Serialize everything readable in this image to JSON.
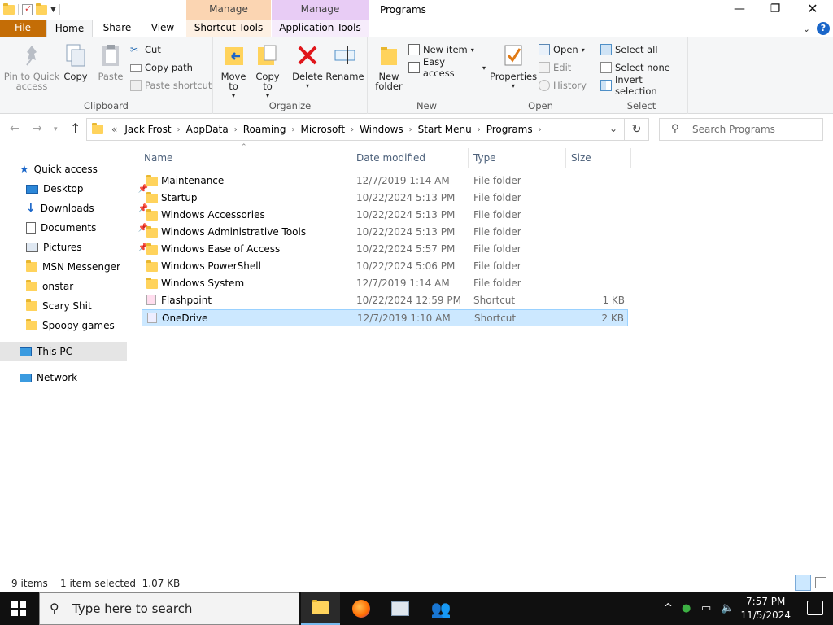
{
  "window": {
    "title": "Programs",
    "context_tabs": {
      "manage_shortcut": "Manage",
      "manage_application": "Manage"
    },
    "tabs": [
      "File",
      "Home",
      "Share",
      "View",
      "Shortcut Tools",
      "Application Tools"
    ],
    "help": "?"
  },
  "ribbon": {
    "clipboard": {
      "label": "Clipboard",
      "pin": "Pin to Quick access",
      "copy": "Copy",
      "paste": "Paste",
      "cut": "Cut",
      "copy_path": "Copy path",
      "paste_shortcut": "Paste shortcut"
    },
    "organize": {
      "label": "Organize",
      "move_to": "Move to",
      "copy_to": "Copy to",
      "delete": "Delete",
      "rename": "Rename"
    },
    "new": {
      "label": "New",
      "new_folder": "New folder",
      "new_item": "New item",
      "easy_access": "Easy access"
    },
    "open": {
      "label": "Open",
      "properties": "Properties",
      "open": "Open",
      "edit": "Edit",
      "history": "History"
    },
    "select": {
      "label": "Select",
      "select_all": "Select all",
      "select_none": "Select none",
      "invert": "Invert selection"
    }
  },
  "address": {
    "prefix": "«",
    "crumbs": [
      "Jack Frost",
      "AppData",
      "Roaming",
      "Microsoft",
      "Windows",
      "Start Menu",
      "Programs"
    ],
    "search_placeholder": "Search Programs"
  },
  "nav": {
    "quick_access": "Quick access",
    "items": [
      "Desktop",
      "Downloads",
      "Documents",
      "Pictures",
      "MSN Messenger",
      "onstar",
      "Scary Shit",
      "Spoopy games"
    ],
    "this_pc": "This PC",
    "network": "Network"
  },
  "columns": [
    "Name",
    "Date modified",
    "Type",
    "Size"
  ],
  "files": [
    {
      "name": "Maintenance",
      "date": "12/7/2019 1:14 AM",
      "type": "File folder",
      "size": ""
    },
    {
      "name": "Startup",
      "date": "10/22/2024 5:13 PM",
      "type": "File folder",
      "size": ""
    },
    {
      "name": "Windows Accessories",
      "date": "10/22/2024 5:13 PM",
      "type": "File folder",
      "size": ""
    },
    {
      "name": "Windows Administrative Tools",
      "date": "10/22/2024 5:13 PM",
      "type": "File folder",
      "size": ""
    },
    {
      "name": "Windows Ease of Access",
      "date": "10/22/2024 5:57 PM",
      "type": "File folder",
      "size": ""
    },
    {
      "name": "Windows PowerShell",
      "date": "10/22/2024 5:06 PM",
      "type": "File folder",
      "size": ""
    },
    {
      "name": "Windows System",
      "date": "12/7/2019 1:14 AM",
      "type": "File folder",
      "size": ""
    },
    {
      "name": "Flashpoint",
      "date": "10/22/2024 12:59 PM",
      "type": "Shortcut",
      "size": "1 KB"
    },
    {
      "name": "OneDrive",
      "date": "12/7/2019 1:10 AM",
      "type": "Shortcut",
      "size": "2 KB"
    }
  ],
  "status": {
    "items": "9 items",
    "selected": "1 item selected  1.07 KB"
  },
  "taskbar": {
    "search_placeholder": "Type here to search",
    "time": "7:57 PM",
    "date": "11/5/2024"
  }
}
